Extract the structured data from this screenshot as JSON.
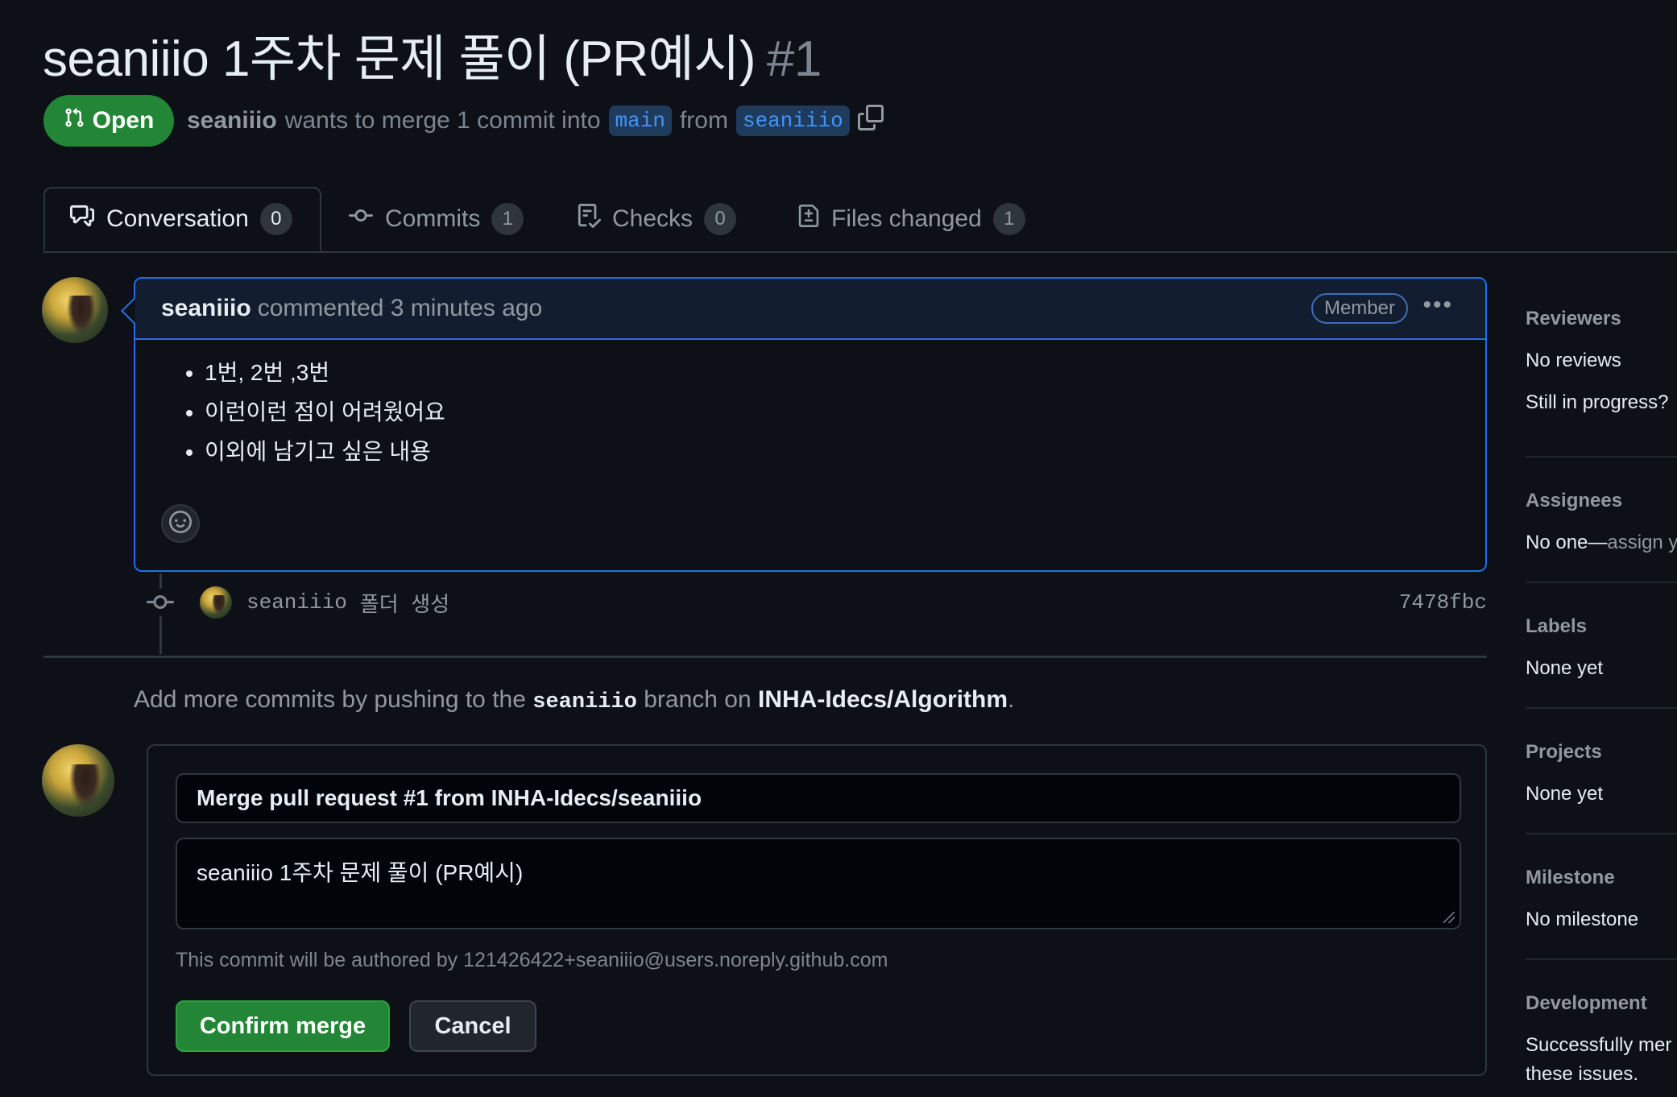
{
  "pr": {
    "title": "seaniiio 1주차 문제 풀이 (PR예시)",
    "number": "#1",
    "state": "Open",
    "author": "seaniiio",
    "merge_text": "wants to merge 1 commit into",
    "base_branch": "main",
    "from_text": "from",
    "head_branch": "seaniiio"
  },
  "tabs": [
    {
      "label": "Conversation",
      "count": "0",
      "icon": "comment-discussion-icon"
    },
    {
      "label": "Commits",
      "count": "1",
      "icon": "git-commit-icon"
    },
    {
      "label": "Checks",
      "count": "0",
      "icon": "checklist-icon"
    },
    {
      "label": "Files changed",
      "count": "1",
      "icon": "file-diff-icon"
    }
  ],
  "comment": {
    "author": "seaniiio",
    "meta": "commented 3 minutes ago",
    "badge": "Member",
    "items": [
      "1번, 2번 ,3번",
      "이런이런 점이 어려웠어요",
      "이외에 남기고 싶은 내용"
    ]
  },
  "commit": {
    "author": "seaniiio",
    "message": "폴더 생성",
    "sha": "7478fbc"
  },
  "push_note": {
    "prefix": "Add more commits by pushing to the",
    "branch": "seaniiio",
    "middle": "branch on",
    "repo": "INHA-Idecs/Algorithm",
    "suffix": "."
  },
  "merge": {
    "title_value": "Merge pull request #1 from INHA-Idecs/seaniiio",
    "body_value": "seaniiio 1주차 문제 풀이 (PR예시)",
    "author_note": "This commit will be authored by 121426422+seaniiio@users.noreply.github.com",
    "confirm_label": "Confirm merge",
    "cancel_label": "Cancel"
  },
  "sidebar": {
    "reviewers": {
      "heading": "Reviewers",
      "value": "No reviews",
      "extra": "Still in progress?"
    },
    "assignees": {
      "heading": "Assignees",
      "value": "No one—",
      "link": "assign y"
    },
    "labels": {
      "heading": "Labels",
      "value": "None yet"
    },
    "projects": {
      "heading": "Projects",
      "value": "None yet"
    },
    "milestone": {
      "heading": "Milestone",
      "value": "No milestone"
    },
    "development": {
      "heading": "Development",
      "value_line1": "Successfully mer",
      "value_line2": "these issues."
    }
  },
  "colors": {
    "background": "#0d1117",
    "open_green": "#238636",
    "accent_blue": "#1f6feb",
    "muted_text": "#9198a1"
  }
}
